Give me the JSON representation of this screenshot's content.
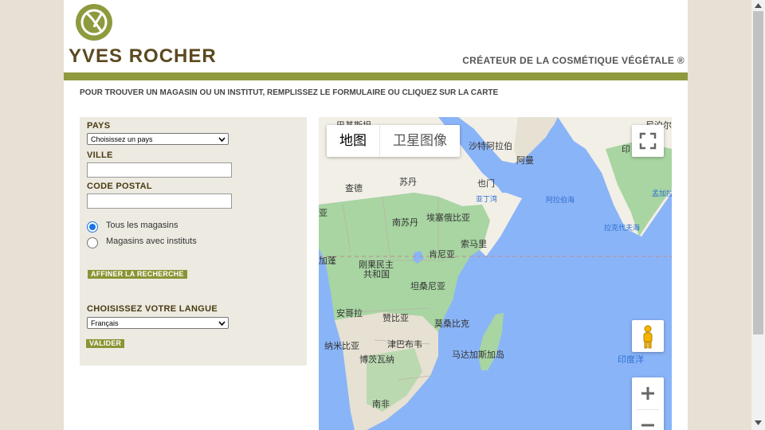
{
  "header": {
    "brand": "YVES ROCHER",
    "tagline": "CRÉATEUR DE LA COSMÉTIQUE VÉGÉTALE ®"
  },
  "instruction": "POUR TROUVER UN MAGASIN OU UN INSTITUT, REMPLISSEZ LE FORMULAIRE OU CLIQUEZ SUR LA CARTE",
  "form": {
    "country_label": "PAYS",
    "country_value": "Choisissez un pays",
    "city_label": "VILLE",
    "city_value": "",
    "postal_label": "CODE POSTAL",
    "postal_value": "",
    "radio_all": "Tous les magasins",
    "radio_institutes": "Magasins avec instituts",
    "refine_button": "AFFINER LA RECHERCHE",
    "language_label": "CHOISISSEZ VOTRE LANGUE",
    "language_value": "Français",
    "validate_button": "VALIDER"
  },
  "map": {
    "type_map": "地图",
    "type_satellite": "卫星图像",
    "labels": {
      "pakistan": "巴基斯坦",
      "saudi": "沙特阿拉伯",
      "oman": "阿曼",
      "india": "印",
      "chad": "查德",
      "sudan": "苏丹",
      "yemen": "也门",
      "gulf_aden": "亚丁湾",
      "arabian_sea": "阿拉伯海",
      "bengal": "孟加拉",
      "laccadive": "拉克代夫海",
      "south_sudan": "南苏丹",
      "ethiopia": "埃塞俄比亚",
      "nigeria_frag": "亚",
      "somalia": "索马里",
      "kenya": "肯尼亚",
      "gabon_frag": "加蓬",
      "drc1": "刚果民主",
      "drc2": "共和国",
      "tanzania": "坦桑尼亚",
      "angola": "安哥拉",
      "zambia": "赞比亚",
      "mozambique": "莫桑比克",
      "madagascar": "马达加斯加岛",
      "indian_ocean": "印度洋",
      "namibia": "纳米比亚",
      "zimbabwe": "津巴布韦",
      "botswana": "博茨瓦纳",
      "south_africa": "南非"
    }
  },
  "colors": {
    "brand_green": "#8f9a3f",
    "brand_brown": "#5b4a20",
    "panel_bg": "#eceae1",
    "water": "#8ab4f8",
    "land": "#f2efe6",
    "forest": "#a8d5a2"
  }
}
